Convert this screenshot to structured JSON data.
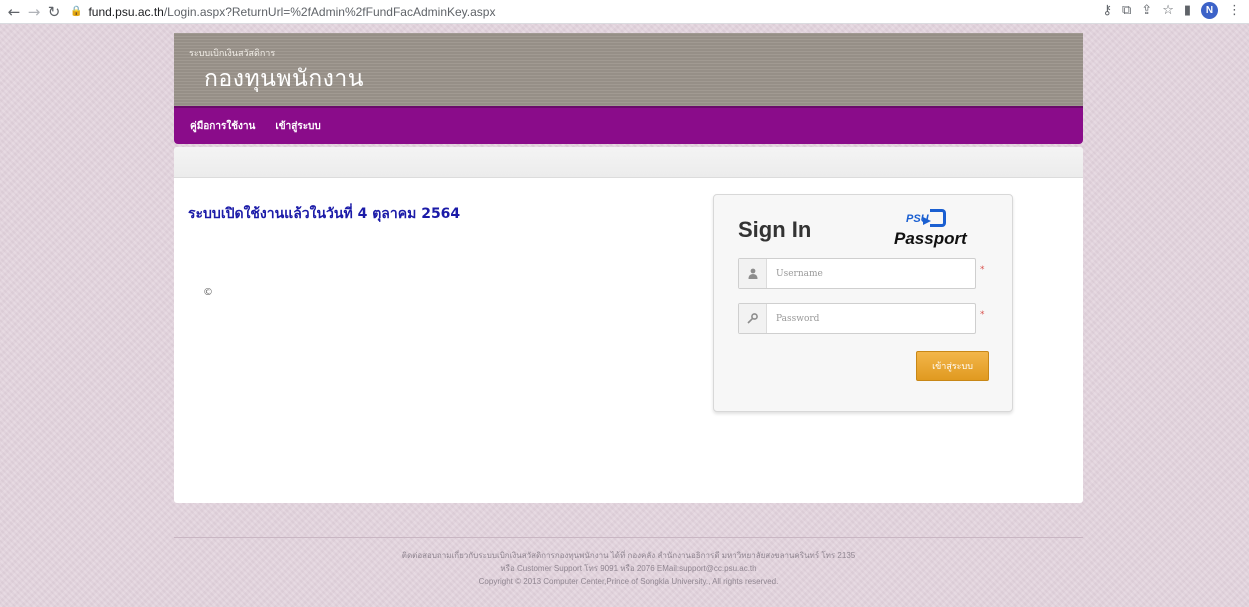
{
  "browser": {
    "url_host": "fund.psu.ac.th",
    "url_path": "/Login.aspx?ReturnUrl=%2fAdmin%2fFundFacAdminKey.aspx",
    "profile_initial": "N"
  },
  "header": {
    "subtitle": "ระบบเบิกเงินสวัสดิการ",
    "title": "กองทุนพนักงาน"
  },
  "menu": {
    "items": [
      {
        "label": "คู่มือการใช้งาน"
      },
      {
        "label": "เข้าสู่ระบบ"
      }
    ]
  },
  "main": {
    "announcement": "ระบบเปิดใช้งานแล้วในวันที่ 4 ตุลาคม 2564",
    "copyright_symbol": "©"
  },
  "signin": {
    "title": "Sign In",
    "logo_psu": "PSU",
    "logo_passport": "Passport",
    "username_placeholder": "Username",
    "password_placeholder": "Password",
    "required_mark": "*",
    "button_label": "เข้าสู่ระบบ"
  },
  "footer": {
    "line1": "ติดต่อสอบถามเกี่ยวกับระบบเบิกเงินสวัสดิการกองทุนพนักงาน ได้ที่ กองคลัง สำนักงานอธิการดี มหาวิทยาลัยสงขลานครินทร์ โทร 2135",
    "line2": "หรือ Customer Support โทร 9091 หรือ 2076 EMail:support@cc.psu.ac.th",
    "line3": "Copyright © 2013 Computer Center,Prince of Songkla University., All rights reserved."
  },
  "colors": {
    "menubar": "#8a0c8a",
    "header_bg": "#9c958c",
    "announcement": "#1b1ba8",
    "button": "#e8a531",
    "page_bg": "#e3d4de"
  }
}
